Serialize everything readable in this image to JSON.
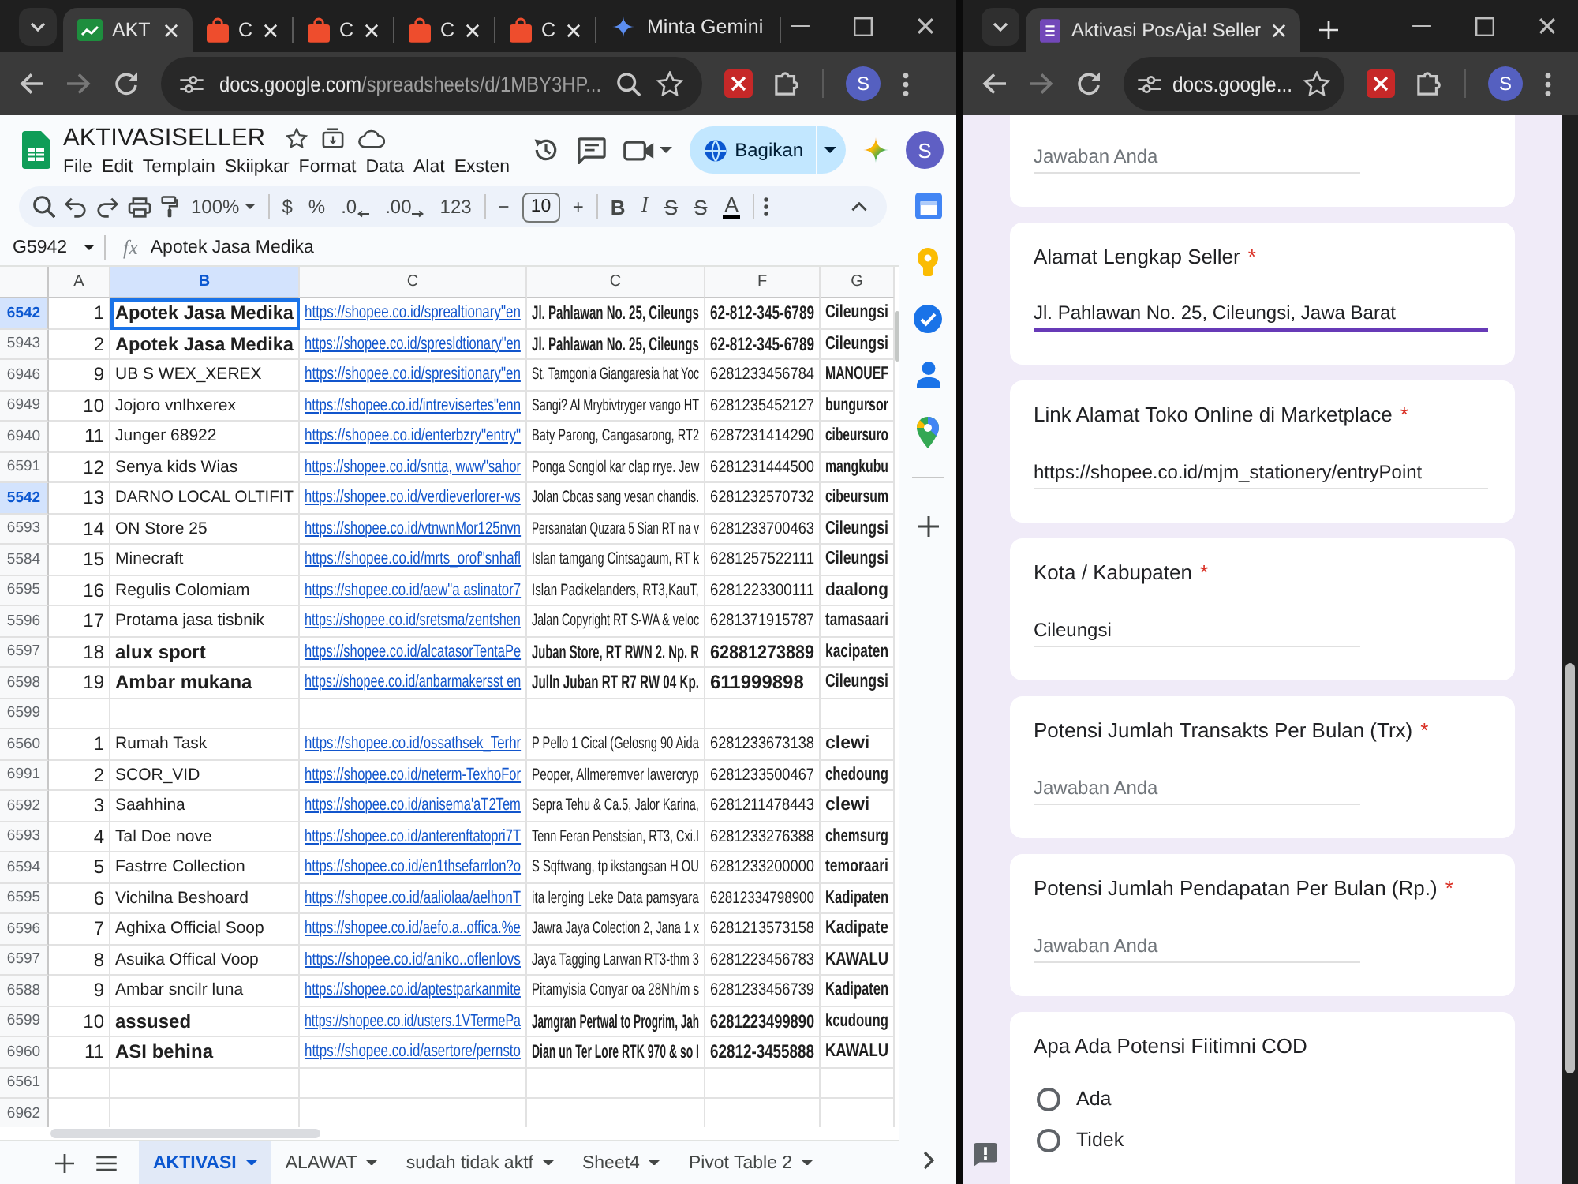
{
  "left_window": {
    "tabs": [
      {
        "kind": "sheets",
        "label": "AKT",
        "selected": true
      },
      {
        "kind": "shop",
        "label": "C",
        "selected": false
      },
      {
        "kind": "shop",
        "label": "C",
        "selected": false
      },
      {
        "kind": "shop",
        "label": "C",
        "selected": false
      },
      {
        "kind": "shop",
        "label": "C",
        "selected": false
      }
    ],
    "gemini_button": "Minta Gemini",
    "url": {
      "host": "docs.google.com",
      "path": "/spreadsheets/d/1MBY3HP..."
    },
    "profile": "S"
  },
  "spreadsheet": {
    "title": "AKTIVASISELLER",
    "menu": [
      "File",
      "Edit",
      "Templain",
      "Skiipkar",
      "Format",
      "Data",
      "Alat",
      "Exsten"
    ],
    "share": "Bagikan",
    "profile": "S",
    "toolbar": {
      "zoom": "100%",
      "number_buttons": [
        "$",
        "%",
        ".0",
        ".00",
        "123"
      ],
      "size_buttons": [
        "−",
        "+"
      ],
      "font_size": "10",
      "style_buttons": [
        "B",
        "I",
        "S",
        "S",
        "A"
      ]
    },
    "formula_bar": {
      "cell": "G5942",
      "fx": "fx",
      "value": "Apotek Jasa Medika"
    },
    "columns": [
      {
        "label": "A",
        "selected": false
      },
      {
        "label": "B",
        "selected": true
      },
      {
        "label": "C",
        "selected": false
      },
      {
        "label": "C",
        "selected": false
      },
      {
        "label": "F",
        "selected": false
      },
      {
        "label": "G",
        "selected": false
      }
    ],
    "rows": [
      {
        "header": "6542",
        "selected": true,
        "active": true,
        "bold": true,
        "cells": [
          "1",
          "Apotek Jasa Medika",
          "https://shopee.co.id/sprealtionary\"en",
          "Jl. Pahlawan No. 25, Cileungs",
          "62-812-345-6789",
          "Cileungsi"
        ]
      },
      {
        "header": "5943",
        "selected": false,
        "active": false,
        "bold": true,
        "cells": [
          "2",
          "Apotek Jasa Medika",
          "https://shopee.co.id/spresldtionary\"en",
          "Jl. Pahlawan No. 25, Cileungs",
          "62-812-345-6789",
          "Cileungsi"
        ]
      },
      {
        "header": "6946",
        "selected": false,
        "active": false,
        "bold": false,
        "cells": [
          "9",
          "UB S WEX_XEREX",
          "https://shopee.co.id/spresitionary\"en",
          "St. Tamgonia Giangaresia hat Yoc",
          "6281233456784",
          "MANOUEF"
        ]
      },
      {
        "header": "6949",
        "selected": false,
        "active": false,
        "bold": false,
        "cells": [
          "10",
          "Jojoro vnlhxerex",
          "https://shopee.co.id/intrevisertes\"enn",
          "Sangi? Al Mrybivtryger vango HT",
          "6281235452127",
          "bungursor"
        ]
      },
      {
        "header": "6940",
        "selected": false,
        "active": false,
        "bold": false,
        "cells": [
          "11",
          "Junger 68922",
          "https://shopee.co.id/enterbzry\"entry\"",
          "Baty Parong, Cangasarong, RT2",
          "6287231414290",
          "cibeursuro"
        ]
      },
      {
        "header": "6591",
        "selected": false,
        "active": false,
        "bold": false,
        "cells": [
          "12",
          "Senya kids Wias",
          "https://shopee.co.id/sntta, www\"sahor",
          "Ponga Songlol kar clap rrye. Jew",
          "6281231444500",
          "mangkubu"
        ]
      },
      {
        "header": "5542",
        "selected": true,
        "active": false,
        "bold": false,
        "cells": [
          "13",
          "DARNO LOCAL OLTIFIT",
          "https://shopee.co.id/verdieverlorer-ws",
          "Jolan Cbcas sang vesan chandis.",
          "6281232570732",
          "cibeursum"
        ]
      },
      {
        "header": "6593",
        "selected": false,
        "active": false,
        "bold": false,
        "cells": [
          "14",
          "ON Store 25",
          "https://shopee.co.id/vtnwnMor125nvn",
          "Persanatan Quzara 5 Sian RT na v",
          "6281233700463",
          "Cileungsi"
        ]
      },
      {
        "header": "5584",
        "selected": false,
        "active": false,
        "bold": false,
        "cells": [
          "15",
          "Minecraft",
          "https://shopee.co.id/mrts_orof\"snhafl",
          "Islan tamgang Cintsagaum, RT k",
          "6281257522111",
          "Cileungsi"
        ]
      },
      {
        "header": "6595",
        "selected": false,
        "active": false,
        "bold": false,
        "cells": [
          "16",
          "Regulis Colomiam",
          "https://shopee.co.id/aew\"a aslinator7",
          "Islan Pacikelanders, RT3,KauT,",
          "6281223300111",
          "daalong"
        ]
      },
      {
        "header": "5596",
        "selected": false,
        "active": false,
        "bold": false,
        "cells": [
          "17",
          "Protama jasa tisbnik",
          "https://shopee.co.id/sretsma/zentshen",
          "Jalan Copyright RT S-WA & veloc",
          "6281371915787",
          "tamasaari"
        ]
      },
      {
        "header": "6597",
        "selected": false,
        "active": false,
        "bold": true,
        "cells": [
          "18",
          "alux sport",
          "https://shopee.co.id/alcatasorTentaPe",
          "Juban Store, RT RWN 2. Np. R",
          "62881273889",
          "kacipaten"
        ]
      },
      {
        "header": "6598",
        "selected": false,
        "active": false,
        "bold": true,
        "cells": [
          "19",
          "Ambar mukana",
          "https://shopee.co.id/anbarmakersst en",
          "Julln Juban RT R7 RW 04 Kp.",
          "611999898",
          "Cileungsi"
        ]
      },
      {
        "header": "6599",
        "selected": false
      },
      {
        "header": "6560",
        "selected": false,
        "active": false,
        "bold": false,
        "cells": [
          "1",
          "Rumah Task",
          "https://shopee.co.id/ossathsek_Terhr",
          "P Pello 1 Cical (Gelosng 90 Aida",
          "6281233673138",
          "clewi"
        ]
      },
      {
        "header": "6991",
        "selected": false,
        "active": false,
        "bold": false,
        "cells": [
          "2",
          "SCOR_VID",
          "https://shopee.co.id/neterm-TexhoFor",
          "Peoper, Allmeremver lawercryp",
          "6281233500467",
          "chedoung"
        ]
      },
      {
        "header": "6592",
        "selected": false,
        "active": false,
        "bold": false,
        "cells": [
          "3",
          "Saahhina",
          "https://shopee.co.id/anisema'aT2Tem",
          "Sepra Tehu & Ca.5, Jalor Karina,",
          "6281211478443",
          "clewi"
        ]
      },
      {
        "header": "6593",
        "selected": false,
        "active": false,
        "bold": false,
        "cells": [
          "4",
          "Tal Doe nove",
          "https://shopee.co.id/anterenftatopri7T",
          "Tenn Feran Penstsian, RT3, Cxi.I",
          "6281233276388",
          "chemsurg"
        ]
      },
      {
        "header": "6594",
        "selected": false,
        "active": false,
        "bold": false,
        "cells": [
          "5",
          "Fastrre Collection",
          "https://shopee.co.id/en1thsefarrlon?o",
          "S Sqftwang, tp ikstangsan H OU",
          "6281233200000",
          "temoraari"
        ]
      },
      {
        "header": "6595",
        "selected": false,
        "active": false,
        "bold": false,
        "cells": [
          "6",
          "Vichilna Beshoard",
          "https://shopee.co.id/aaliolaa/aelhonT",
          "ita lerging Leke Data pamsyara",
          "62812334798900",
          "Kadipaten"
        ]
      },
      {
        "header": "6596",
        "selected": false,
        "active": false,
        "bold": false,
        "cells": [
          "7",
          "Aghixa Official Soop",
          "https://shopee.co.id/aefo.a..offica.%e",
          "Jawra Jaya Colection 2, Jana 1 x",
          "6281213573158",
          "Kadipate"
        ]
      },
      {
        "header": "6597",
        "selected": false,
        "active": false,
        "bold": false,
        "cells": [
          "8",
          "Asuika Offical Voop",
          "https://shopee.co.id/aniko..oflenlovs",
          "Jaya Tagging Larwan RT3-thm 3",
          "6281223456783",
          "KAWALU"
        ]
      },
      {
        "header": "6588",
        "selected": false,
        "active": false,
        "bold": false,
        "cells": [
          "9",
          "Ambar sncilr luna",
          "https://shopee.co.id/aptestparkanmite",
          "Pitamyisia Conyar oa 28Nh/m s",
          "6281233456739",
          "Kadipaten"
        ]
      },
      {
        "header": "6599",
        "selected": false,
        "active": false,
        "bold": true,
        "cells": [
          "10",
          "assused",
          "https://shopee.co.id/usters.1VTermePa",
          "Jamgran Pertwal to Progrim, Jah",
          "6281223499890",
          "kcudoung"
        ]
      },
      {
        "header": "6960",
        "selected": false,
        "active": false,
        "bold": true,
        "cells": [
          "11",
          "ASI behina",
          "https://shopee.co.id/asertore/pernsto",
          "Dian un Ter Lore RTK 970 & so I",
          "62812-3455888",
          "KAWALU"
        ]
      },
      {
        "header": "6561",
        "selected": false
      },
      {
        "header": "6962",
        "selected": false
      }
    ],
    "sheet_tabs": [
      {
        "label": "AKTIVASI",
        "selected": true
      },
      {
        "label": "ALAWAT",
        "selected": false
      },
      {
        "label": "sudah tidak aktf",
        "selected": false
      },
      {
        "label": "Sheet4",
        "selected": false
      },
      {
        "label": "Pivot Table 2",
        "selected": false
      }
    ]
  },
  "right_window": {
    "tabs": [
      {
        "kind": "forms",
        "label": "Aktivasi PosAja! Seller",
        "selected": true
      }
    ],
    "url": {
      "host": "docs.google..."
    },
    "profile": "S"
  },
  "form": {
    "questions": [
      {
        "kind": "short_text",
        "placeholder": "Jawaban Anda",
        "focused": false
      },
      {
        "kind": "long_text",
        "title": "Alamat Lengkap Seller",
        "required_mark": "*",
        "value": "Jl. Pahlawan No. 25, Cileungsi, Jawa Barat",
        "focused": true
      },
      {
        "kind": "long_text",
        "title": "Link Alamat Toko Online di Marketplace",
        "required_mark": "*",
        "value": "https://shopee.co.id/mjm_stationery/entryPoint",
        "focused": false
      },
      {
        "kind": "short_text",
        "title": "Kota / Kabupaten",
        "required_mark": "*",
        "value": "Cileungsi",
        "focused": false
      },
      {
        "kind": "short_text",
        "title": "Potensi Jumlah Transakts Per Bulan (Trx)",
        "required_mark": "*",
        "placeholder": "Jawaban Anda",
        "focused": false
      },
      {
        "kind": "short_text",
        "title": "Potensi Jumlah Pendapatan Per Bulan (Rp.)",
        "required_mark": "*",
        "placeholder": "Jawaban Anda",
        "focused": false
      },
      {
        "kind": "radio",
        "title": "Apa Ada Potensi Fiitimni COD",
        "options": [
          {
            "label": "Ada",
            "selected": false
          },
          {
            "label": "Tidek",
            "selected": false
          }
        ]
      }
    ]
  }
}
